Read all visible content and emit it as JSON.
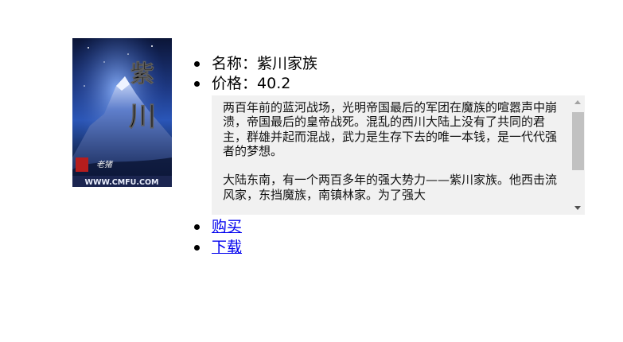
{
  "book": {
    "cover": {
      "title_glyphs": "紫川",
      "site_watermark": "WWW.CMFU.COM",
      "seal_text": "起点",
      "author_script": "老猪"
    },
    "name_label": "名称：",
    "name_value": "紫川家族",
    "price_label": "价格：",
    "price_value": "40.2",
    "description": "两百年前的蓝河战场，光明帝国最后的军团在魔族的喧嚣声中崩溃，帝国最后的皇帝战死。混乱的西川大陆上没有了共同的君主，群雄并起而混战，武力是生存下去的唯一本钱，是一代代强者的梦想。\n\n大陆东南，有一个两百多年的强大势力——紫川家族。他西击流风家，东挡魔族，南镇林家。为了强大"
  },
  "links": {
    "buy": "购买",
    "download": "下载"
  },
  "colors": {
    "link": "#0000ee",
    "desc_background": "#f1f1f1",
    "scroll_thumb": "#c1c1c1"
  }
}
